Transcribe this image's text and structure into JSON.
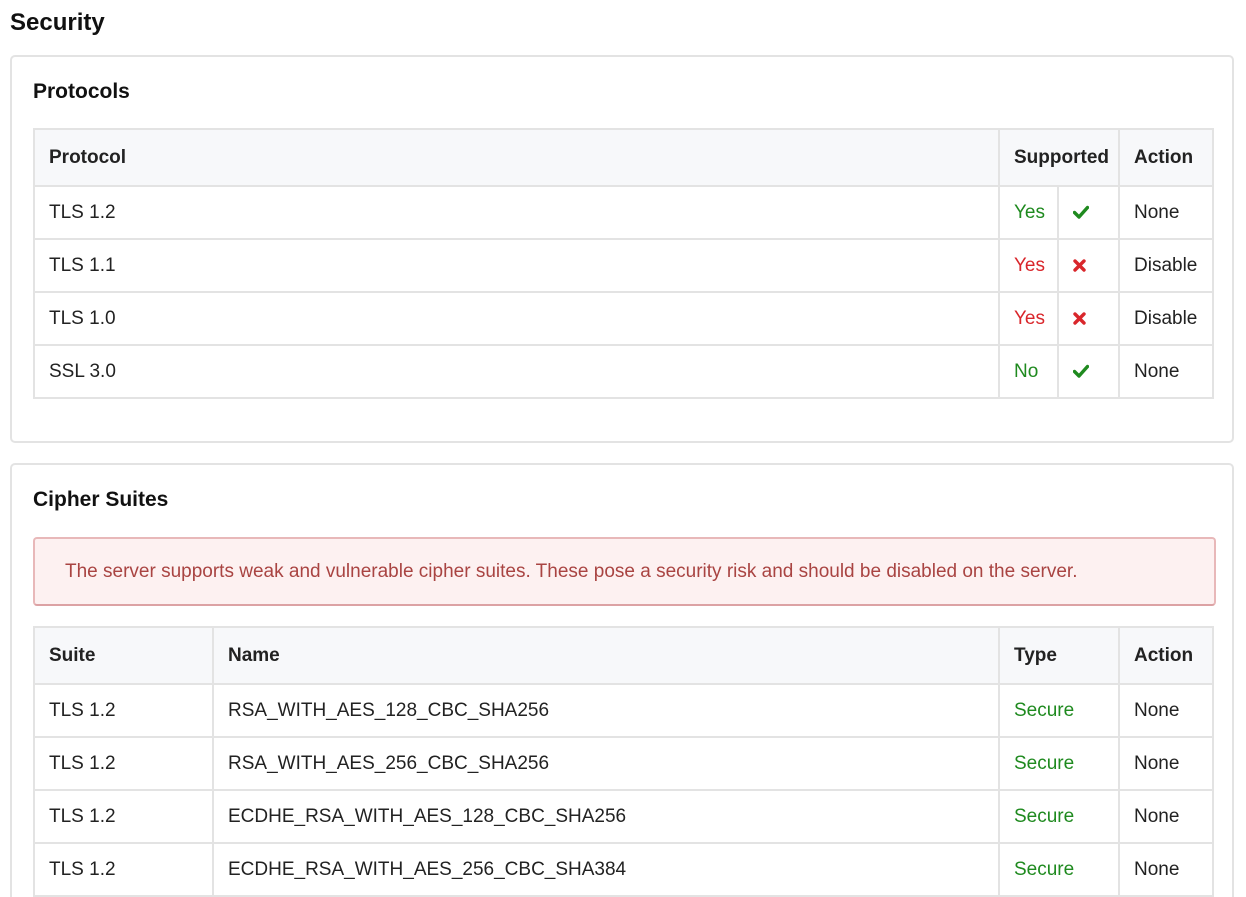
{
  "page": {
    "title": "Security"
  },
  "protocols": {
    "title": "Protocols",
    "columns": {
      "protocol": "Protocol",
      "supported": "Supported",
      "action": "Action"
    },
    "rows": [
      {
        "protocol": "TLS 1.2",
        "supported": "Yes",
        "status": "good",
        "icon": "check-icon",
        "action": "None"
      },
      {
        "protocol": "TLS 1.1",
        "supported": "Yes",
        "status": "bad",
        "icon": "x-icon",
        "action": "Disable"
      },
      {
        "protocol": "TLS 1.0",
        "supported": "Yes",
        "status": "bad",
        "icon": "x-icon",
        "action": "Disable"
      },
      {
        "protocol": "SSL 3.0",
        "supported": "No",
        "status": "good",
        "icon": "check-icon",
        "action": "None"
      }
    ]
  },
  "ciphers": {
    "title": "Cipher Suites",
    "alert": "The server supports weak and vulnerable cipher suites. These pose a security risk and should be disabled on the server.",
    "columns": {
      "suite": "Suite",
      "name": "Name",
      "type": "Type",
      "action": "Action"
    },
    "rows": [
      {
        "suite": "TLS 1.2",
        "name": "RSA_WITH_AES_128_CBC_SHA256",
        "type": "Secure",
        "action": "None"
      },
      {
        "suite": "TLS 1.2",
        "name": "RSA_WITH_AES_256_CBC_SHA256",
        "type": "Secure",
        "action": "None"
      },
      {
        "suite": "TLS 1.2",
        "name": "ECDHE_RSA_WITH_AES_128_CBC_SHA256",
        "type": "Secure",
        "action": "None"
      },
      {
        "suite": "TLS 1.2",
        "name": "ECDHE_RSA_WITH_AES_256_CBC_SHA384",
        "type": "Secure",
        "action": "None"
      }
    ]
  },
  "colors": {
    "good": "#1f8a1f",
    "bad": "#d9262b",
    "alert_text": "#a94442",
    "alert_bg": "#fdf1f1",
    "border": "#e3e3e3",
    "header_bg": "#f7f8fa"
  }
}
